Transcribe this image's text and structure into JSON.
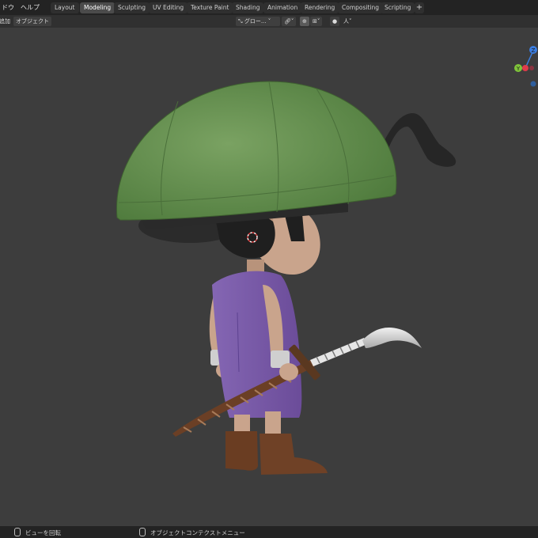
{
  "menu": {
    "item1": "ドウ",
    "item2": "ヘルプ"
  },
  "workspace_tabs": [
    "Layout",
    "Modeling",
    "Sculpting",
    "UV Editing",
    "Texture Paint",
    "Shading",
    "Animation",
    "Rendering",
    "Compositing",
    "Scripting"
  ],
  "active_tab": "Modeling",
  "header": {
    "add_menu": "追加",
    "object_menu": "オブジェクト",
    "transform_orientation": "グロー...",
    "snap_symbol": "⊕",
    "proportional_symbol": "人"
  },
  "gizmo": {
    "z_label": "Z",
    "y_label": "Y"
  },
  "status_bar": {
    "left_action": "ビューを回転",
    "middle_action": "オブジェクトコンテクストメニュー"
  },
  "colors": {
    "viewport_bg": "#3d3d3d",
    "hat_green": "#5f8a4a",
    "tunic_purple": "#7a5aa8",
    "skin": "#c9a48c",
    "boots_brown": "#6a3d22",
    "axis_z": "#3b7de0",
    "axis_y": "#7fc43a",
    "axis_x": "#e03b4a"
  }
}
